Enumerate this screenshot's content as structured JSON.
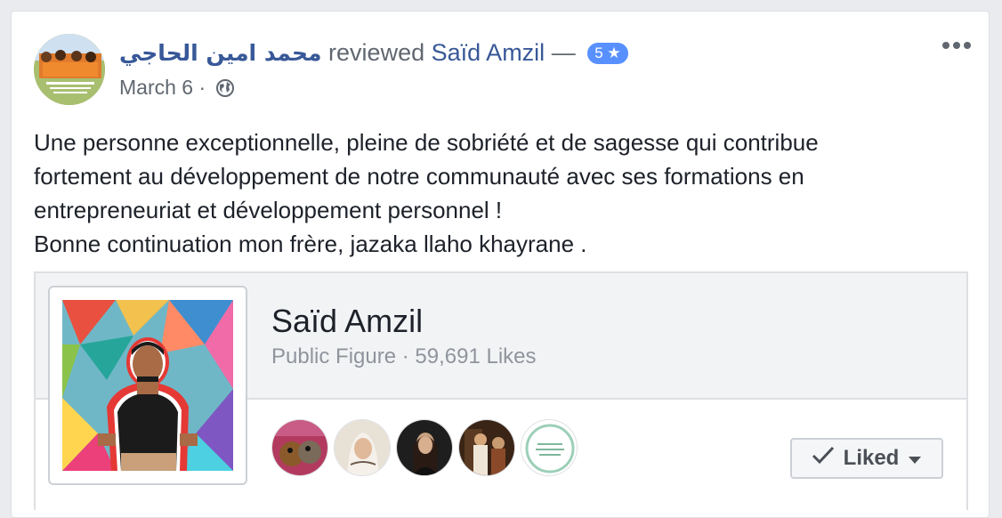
{
  "post": {
    "author_name": "محمد امين الحاجي",
    "action_text": "reviewed",
    "reviewed_page": "Saïd Amzil",
    "dash": "—",
    "rating_label": "5 ★",
    "date": "March 6",
    "date_separator": "·",
    "privacy_icon": "globe-icon",
    "more_icon": "ellipsis-icon",
    "text": "Une personne exceptionnelle, pleine de sobriété et de sagesse qui contribue\nfortement au développement de notre communauté avec ses formations en\nentrepreneuriat et développement personnel !\nBonne continuation mon frère, jazaka llaho khayrane ."
  },
  "attachment": {
    "page_name": "Saïd Amzil",
    "category": "Public Figure",
    "separator": "·",
    "likes": "59,691 Likes",
    "liked_button_label": "Liked",
    "liked_check_icon": "check-icon",
    "liked_caret_icon": "caret-down-icon",
    "fan_avatars": [
      "fan-avatar-1",
      "fan-avatar-2",
      "fan-avatar-3",
      "fan-avatar-4",
      "fan-avatar-5"
    ]
  },
  "colors": {
    "link": "#385898",
    "secondary_text": "#606770",
    "badge": "#5890ff",
    "body_text": "#1d2129"
  }
}
